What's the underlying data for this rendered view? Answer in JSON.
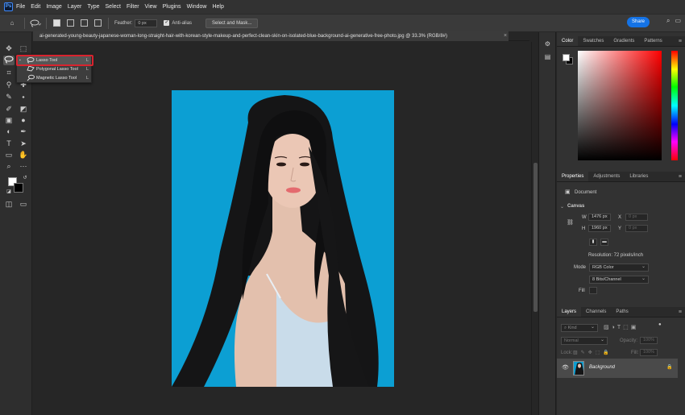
{
  "app": {
    "logo": "Ps"
  },
  "menubar": {
    "items": [
      "File",
      "Edit",
      "Image",
      "Layer",
      "Type",
      "Select",
      "Filter",
      "View",
      "Plugins",
      "Window",
      "Help"
    ]
  },
  "options": {
    "feather_label": "Feather:",
    "feather_value": "0 px",
    "antialias_label": "Anti-alias",
    "select_mask_label": "Select and Mask...",
    "share_label": "Share"
  },
  "document": {
    "tab_title": "ai-generated-young-beauty-japanese-woman-long-straight-hair-with-korean-style-makeup-and-perfect-clean-skin-on-isolated-blue-background-ai-generative-free-photo.jpg @ 33.3% (RGB/8#)",
    "close": "×"
  },
  "tool_menu": {
    "items": [
      {
        "label": "Lasso Tool",
        "shortcut": "L",
        "icon": "lasso-icon"
      },
      {
        "label": "Polygonal Lasso Tool",
        "shortcut": "L",
        "icon": "polygonal-lasso-icon"
      },
      {
        "label": "Magnetic Lasso Tool",
        "shortcut": "L",
        "icon": "magnetic-lasso-icon"
      }
    ]
  },
  "color_panel": {
    "tabs": [
      "Color",
      "Swatches",
      "Gradients",
      "Patterns"
    ],
    "foreground": "#ffffff",
    "background": "#000000"
  },
  "properties_panel": {
    "tabs": [
      "Properties",
      "Adjustments",
      "Libraries"
    ],
    "doc_label": "Document",
    "canvas_label": "Canvas",
    "w_label": "W",
    "w_value": "1476 px",
    "h_label": "H",
    "h_value": "1960 px",
    "x_label": "X",
    "x_value": "0 px",
    "y_label": "Y",
    "y_value": "0 px",
    "resolution": "Resolution: 72 pixels/inch",
    "mode_label": "Mode",
    "mode_value": "RGB Color",
    "depth_value": "8 Bits/Channel",
    "fill_label": "Fill"
  },
  "layers_panel": {
    "tabs": [
      "Layers",
      "Channels",
      "Paths"
    ],
    "kind_label": "Kind",
    "blend_mode": "Normal",
    "opacity_label": "Opacity:",
    "opacity_value": "100%",
    "lock_label": "Lock:",
    "fill_label": "Fill:",
    "fill_value": "100%",
    "layers": [
      {
        "name": "Background"
      }
    ]
  },
  "colors": {
    "accent": "#1473e6",
    "highlight": "#d9232e",
    "canvas_bg": "#0c9fd3"
  }
}
